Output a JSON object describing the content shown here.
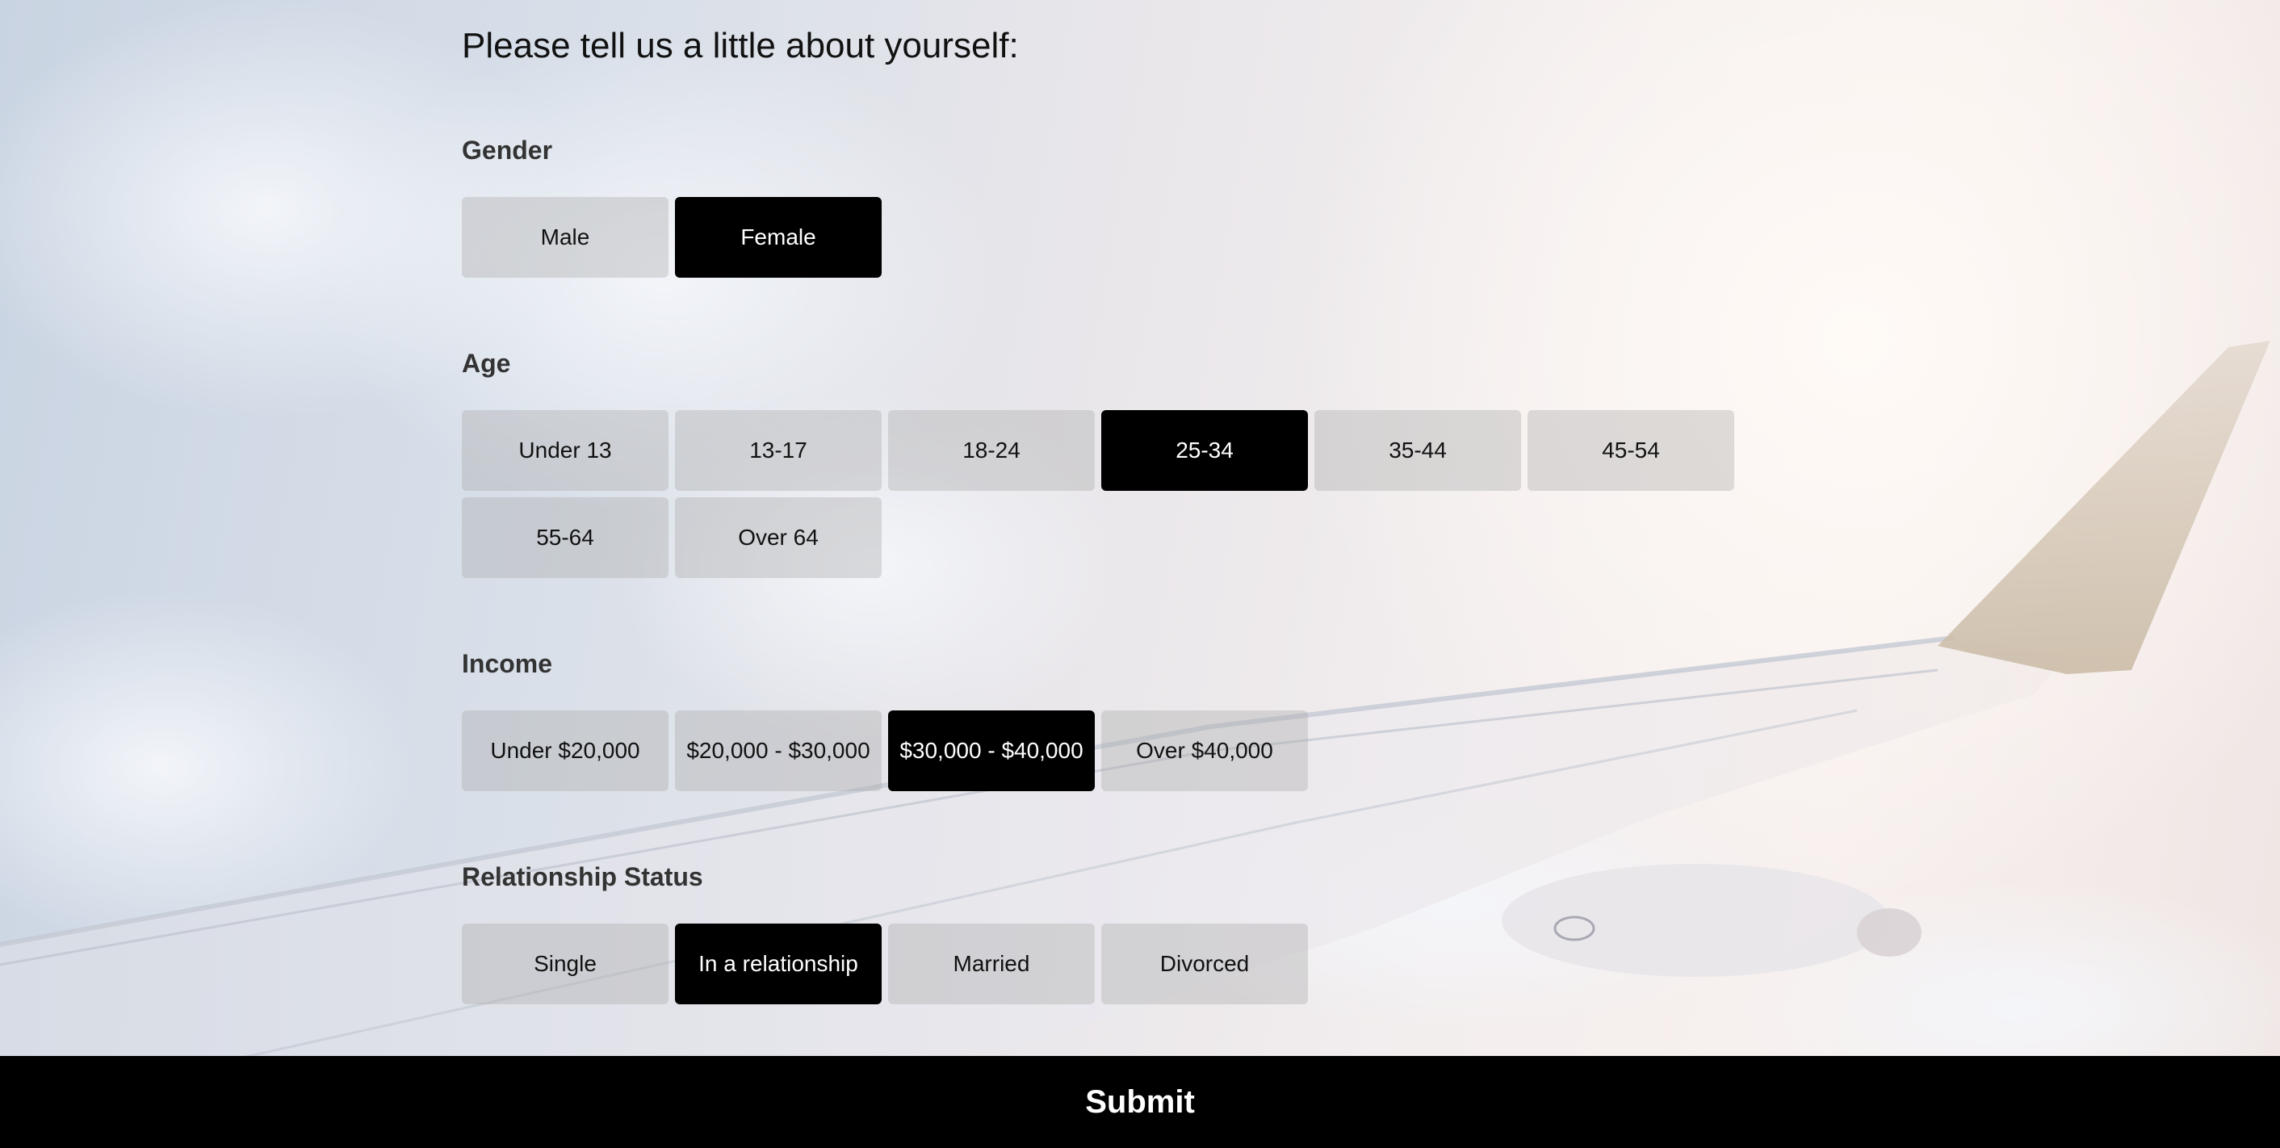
{
  "heading": "Please tell us a little about yourself:",
  "gender": {
    "label": "Gender",
    "options": [
      {
        "label": "Male",
        "selected": false
      },
      {
        "label": "Female",
        "selected": true
      }
    ]
  },
  "age": {
    "label": "Age",
    "options": [
      {
        "label": "Under 13",
        "selected": false
      },
      {
        "label": "13-17",
        "selected": false
      },
      {
        "label": "18-24",
        "selected": false
      },
      {
        "label": "25-34",
        "selected": true
      },
      {
        "label": "35-44",
        "selected": false
      },
      {
        "label": "45-54",
        "selected": false
      },
      {
        "label": "55-64",
        "selected": false
      },
      {
        "label": "Over 64",
        "selected": false
      }
    ]
  },
  "income": {
    "label": "Income",
    "options": [
      {
        "label": "Under $20,000",
        "selected": false
      },
      {
        "label": "$20,000 - $30,000",
        "selected": false
      },
      {
        "label": "$30,000 - $40,000",
        "selected": true
      },
      {
        "label": "Over $40,000",
        "selected": false
      }
    ]
  },
  "relationship": {
    "label": "Relationship Status",
    "options": [
      {
        "label": "Single",
        "selected": false
      },
      {
        "label": "In a relationship",
        "selected": true
      },
      {
        "label": "Married",
        "selected": false
      },
      {
        "label": "Divorced",
        "selected": false
      }
    ]
  },
  "submit": {
    "label": "Submit"
  },
  "colors": {
    "selected_bg": "#000000",
    "option_bg": "rgba(170,170,170,0.38)",
    "submit_bar": "#000000"
  }
}
